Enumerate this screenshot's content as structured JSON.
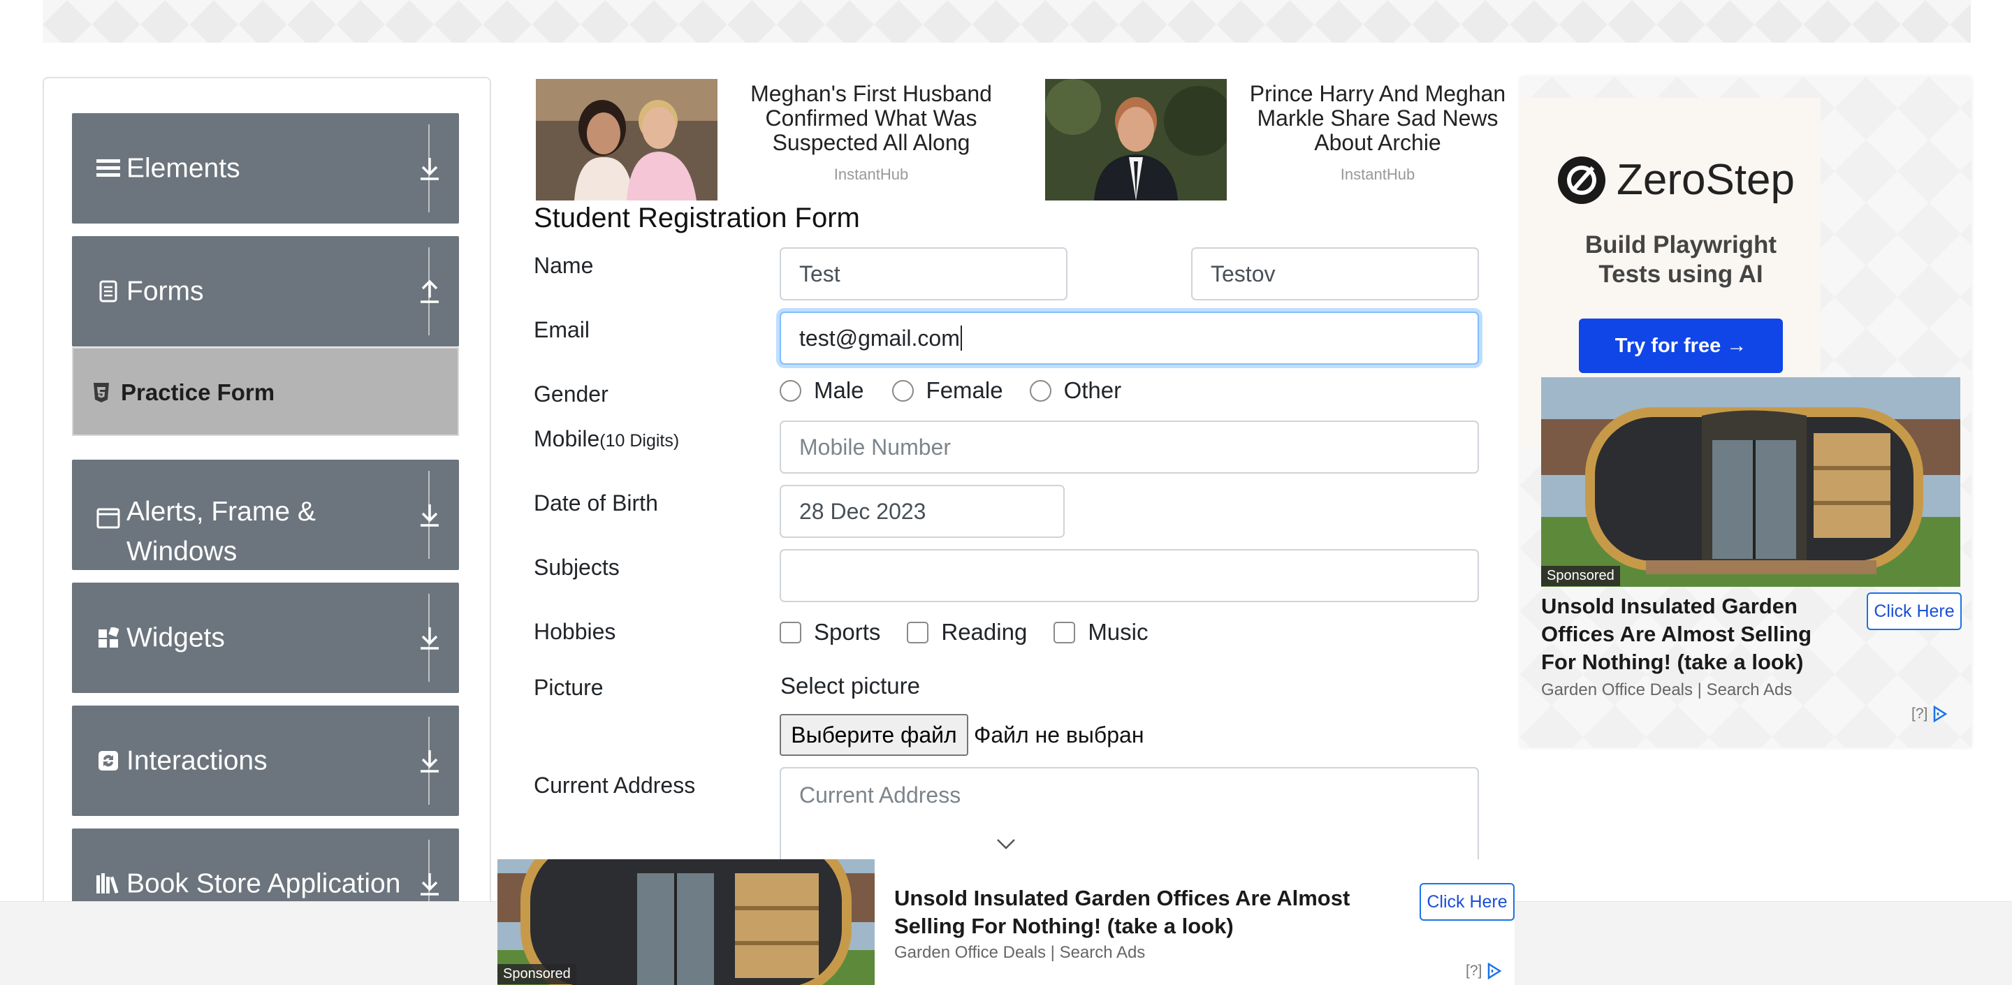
{
  "sidebar": {
    "groups": [
      {
        "label": "Elements",
        "icon": "menu-icon",
        "arrow": "download-icon"
      },
      {
        "label": "Forms",
        "icon": "document-icon",
        "arrow": "upload-icon"
      },
      {
        "label": "Alerts, Frame & Windows",
        "icon": "window-icon",
        "arrow": "download-icon"
      },
      {
        "label": "Widgets",
        "icon": "widgets-icon",
        "arrow": "download-icon"
      },
      {
        "label": "Interactions",
        "icon": "interactions-icon",
        "arrow": "download-icon"
      },
      {
        "label": "Book Store Application",
        "icon": "books-icon",
        "arrow": "download-icon"
      }
    ],
    "active_item": {
      "label": "Practice Form",
      "icon": "html5-icon"
    }
  },
  "top_ads": [
    {
      "title": "Meghan's First Husband Confirmed What Was Suspected All Along",
      "source": "InstantHub"
    },
    {
      "title": "Prince Harry And Meghan Markle Share Sad News About Archie",
      "source": "InstantHub"
    }
  ],
  "form": {
    "title": "Student Registration Form",
    "name_label": "Name",
    "first_name": "Test",
    "last_name": "Testov",
    "email_label": "Email",
    "email_value": "test@gmail.com",
    "gender_label": "Gender",
    "gender_options": [
      "Male",
      "Female",
      "Other"
    ],
    "mobile_label": "Mobile",
    "mobile_hint": "(10 Digits)",
    "mobile_placeholder": "Mobile Number",
    "dob_label": "Date of Birth",
    "dob_value": "28 Dec 2023",
    "subjects_label": "Subjects",
    "subjects_value": "",
    "hobbies_label": "Hobbies",
    "hobbies_options": [
      "Sports",
      "Reading",
      "Music"
    ],
    "picture_label": "Picture",
    "select_picture": "Select picture",
    "file_button": "Выберите файл",
    "file_status": "Файл не выбран",
    "address_label": "Current Address",
    "address_placeholder": "Current Address"
  },
  "right_ad": {
    "brand": "ZeroStep",
    "tagline": "Build Playwright Tests using AI",
    "cta": "Try for free →",
    "sponsored": "Sponsored",
    "headline": "Unsold Insulated Garden Offices Are Almost Selling For Nothing! (take a look)",
    "sub": "Garden Office Deals | Search Ads",
    "click": "Click Here",
    "adchoice": "[?]"
  },
  "bottom_ad": {
    "sponsored": "Sponsored",
    "headline": "Unsold Insulated Garden Offices Are Almost Selling For Nothing! (take a look)",
    "sub": "Garden Office Deals | Search Ads",
    "click": "Click Here",
    "adchoice": "[?]"
  },
  "colors": {
    "sidebar_bg": "#6c757d",
    "active_item_bg": "#b4b4b4",
    "cta_blue": "#1046e8",
    "focus": "#80bdff"
  }
}
